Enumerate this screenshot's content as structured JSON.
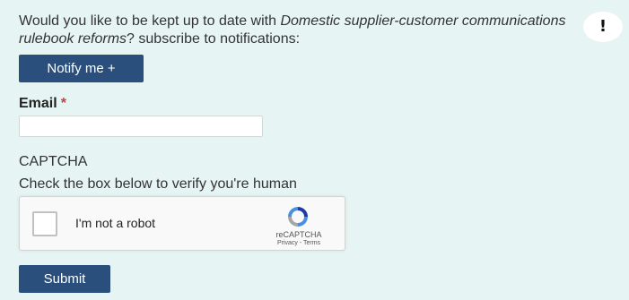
{
  "subscribe": {
    "intro_prefix": "Would you like to be kept up to date with ",
    "intro_topic": "Domestic supplier-customer communications rulebook reforms",
    "intro_suffix": "? subscribe to notifications:",
    "alert_icon": "!",
    "notify_button": "Notify me +"
  },
  "form": {
    "email_label": "Email",
    "email_required_mark": "*",
    "email_value": "",
    "captcha_title": "CAPTCHA",
    "captcha_help": "Check the box below to verify you're human",
    "recaptcha_checkbox_label": "I'm not a robot",
    "recaptcha_brand": "reCAPTCHA",
    "recaptcha_links": "Privacy - Terms",
    "submit_button": "Submit"
  },
  "colors": {
    "panel_background": "#e6f4f3",
    "button_background": "#2a4f7d",
    "required_star": "#d23b3b"
  }
}
